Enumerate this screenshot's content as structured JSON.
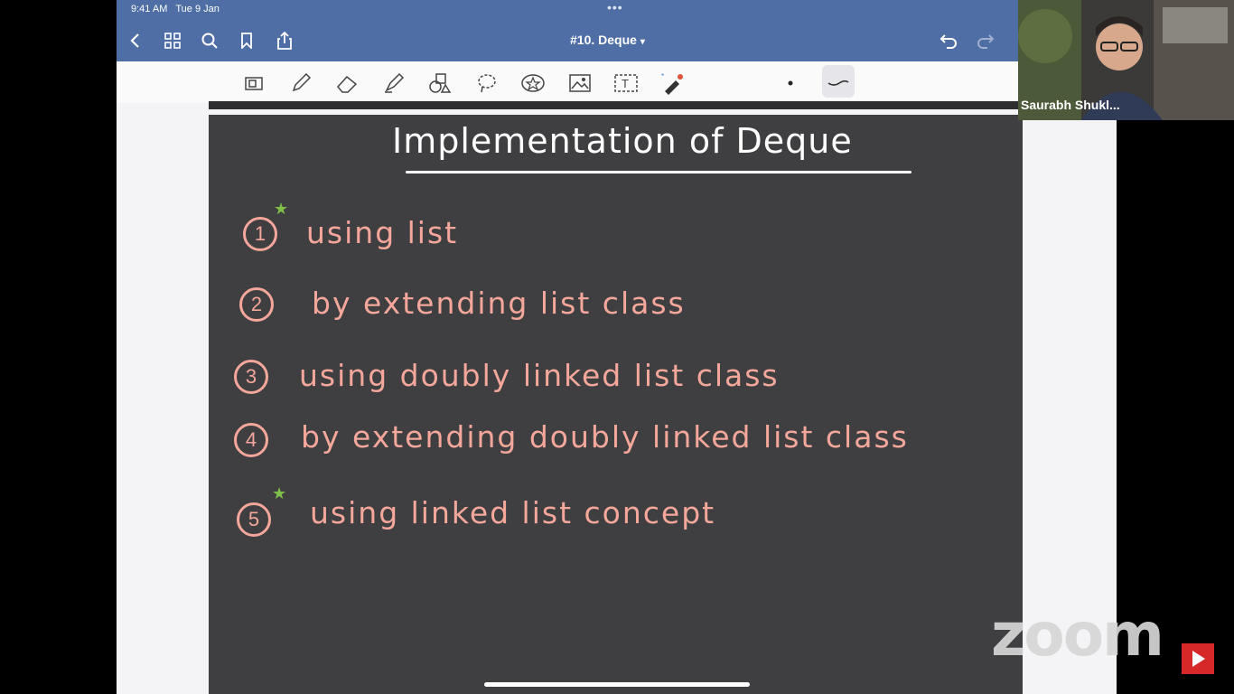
{
  "status": {
    "time": "9:41 AM",
    "date": "Tue 9 Jan"
  },
  "header": {
    "title": "#10. Deque",
    "more_dots": "•••"
  },
  "note": {
    "heading": "Implementation of Deque",
    "items": [
      {
        "number": "1",
        "text": "using list",
        "starred": true
      },
      {
        "number": "2",
        "text": "by extending list class",
        "starred": false
      },
      {
        "number": "3",
        "text": "using doubly linked list class",
        "starred": false
      },
      {
        "number": "4",
        "text": "by extending doubly linked list class",
        "starred": false
      },
      {
        "number": "5",
        "text": "using linked list concept",
        "starred": true
      }
    ]
  },
  "video": {
    "participant_name": "Saurabh Shukl..."
  },
  "watermark": {
    "brand": "zoom"
  },
  "colors": {
    "ink_pink": "#f4a79a",
    "ink_white": "#ffffff",
    "star_green": "#7fbf4a",
    "board": "#3f3f41",
    "topbar": "#4f6ea5"
  }
}
